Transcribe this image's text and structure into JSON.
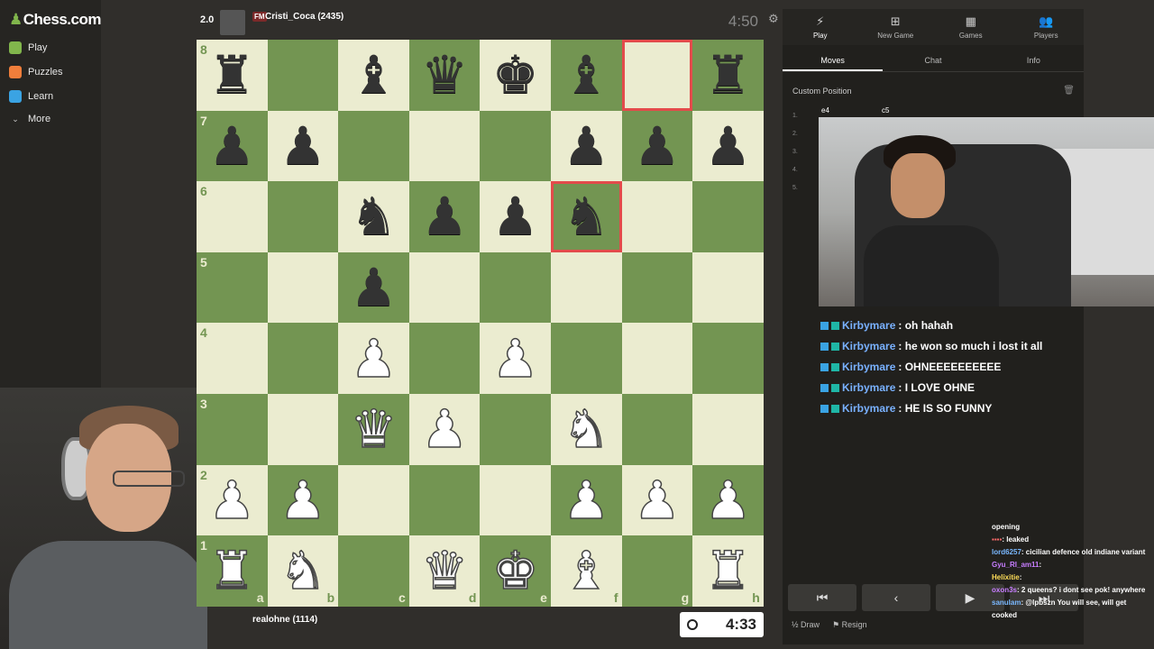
{
  "nav": {
    "logo": "Chess.com",
    "items": [
      {
        "label": "Play",
        "color": "#81b64c"
      },
      {
        "label": "Puzzles",
        "color": "#f07e3b"
      },
      {
        "label": "Learn",
        "color": "#3aa3e3"
      },
      {
        "label": "More",
        "color": "#cccccc"
      }
    ]
  },
  "top_player": {
    "rating_badge": "2.0",
    "title": "FM",
    "name": "Cristi_Coca (2435)",
    "clock": "4:50"
  },
  "bottom_player": {
    "name": "realohne (1114)",
    "clock": "4:33"
  },
  "board": {
    "ranks": [
      "8",
      "7",
      "6",
      "5",
      "4",
      "3",
      "2",
      "1"
    ],
    "files": [
      "a",
      "b",
      "c",
      "d",
      "e",
      "f",
      "g",
      "h"
    ],
    "rows": [
      [
        "br",
        "",
        "bb",
        "bq",
        "bk",
        "bb",
        "",
        "br"
      ],
      [
        "bp",
        "bp",
        "",
        "",
        "",
        "bp",
        "bp",
        "bp"
      ],
      [
        "",
        "",
        "bn",
        "bp",
        "bp",
        "bn",
        "",
        ""
      ],
      [
        "",
        "",
        "bp",
        "",
        "",
        "",
        "",
        ""
      ],
      [
        "",
        "",
        "wp",
        "",
        "wp",
        "",
        "",
        ""
      ],
      [
        "",
        "",
        "wq",
        "wp",
        "",
        "wn",
        "",
        ""
      ],
      [
        "wp",
        "wp",
        "",
        "",
        "",
        "wp",
        "wp",
        "wp"
      ],
      [
        "wr",
        "wn",
        "",
        "wq",
        "wk",
        "wb",
        "",
        "wr"
      ]
    ],
    "highlight": [
      "g8",
      "f6"
    ],
    "colors": {
      "light": "#ebecd0",
      "dark": "#739552",
      "highlight": "#e34b4b"
    }
  },
  "panel": {
    "tabs": [
      {
        "label": "Play",
        "icon": "bolt-icon"
      },
      {
        "label": "New Game",
        "icon": "plus-icon"
      },
      {
        "label": "Games",
        "icon": "grid-icon"
      },
      {
        "label": "Players",
        "icon": "players-icon"
      }
    ],
    "subtabs": [
      "Moves",
      "Chat",
      "Info"
    ],
    "custom_position": "Custom Position",
    "moves": {
      "numbers": [
        "1.",
        "2.",
        "3.",
        "4.",
        "5."
      ],
      "white1": "e4",
      "black1": "c5"
    },
    "draw": "Draw",
    "resign": "Resign"
  },
  "chat": [
    {
      "user": "Kirbymare",
      "text": ": oh hahah"
    },
    {
      "user": "Kirbymare",
      "text": ": he won so much i lost it all"
    },
    {
      "user": "Kirbymare",
      "text": ": OHNEEEEEEEEEE"
    },
    {
      "user": "Kirbymare",
      "text": ": I LOVE OHNE"
    },
    {
      "user": "Kirbymare",
      "text": ": HE IS SO FUNNY"
    }
  ],
  "chat2": {
    "l0": "opening",
    "l1": ": leaked",
    "l2_user": "lord6257",
    "l2": ": cicilian defence old indiane variant",
    "l3_user": "Gyu_RI_am11",
    "l4_user": "Helixitie",
    "l5_user": "oxon3s",
    "l5": ": 2 queens? i dont see pok! anywhere",
    "l6_user": "sanulam",
    "l6": ": @lpbszn You will see, will get cooked"
  }
}
